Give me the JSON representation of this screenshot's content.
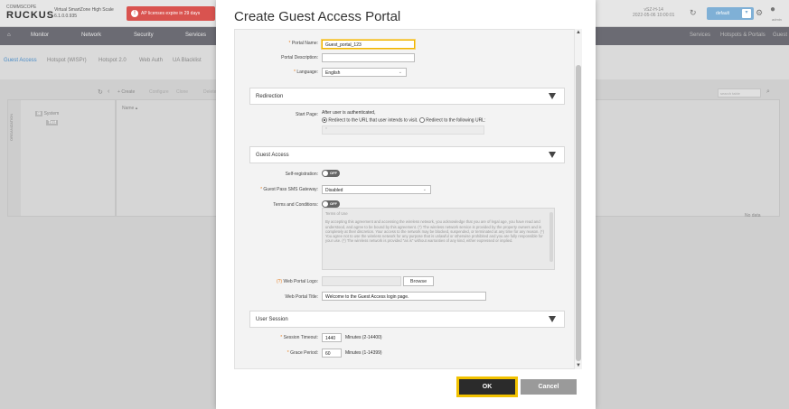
{
  "background": {
    "brand_top": "COMMSCOPE",
    "brand": "RUCKUS",
    "product": "Virtual SmartZone",
    "product_edition": "High Scale",
    "version": "6.1.0.0.935",
    "license_alert": "AP licenses expire in 29 days",
    "controller_name": "vSZ-H-14",
    "controller_date": "2022-05-06 10:00:01",
    "domain_select": "default",
    "user": "admin",
    "nav": [
      "Monitor",
      "Network",
      "Security",
      "Services"
    ],
    "nav_right": [
      "Services",
      "Hotspots & Portals",
      "Guest"
    ],
    "subtabs": [
      "Guest Access",
      "Hotspot (WISPr)",
      "Hotspot 2.0",
      "Web Auth",
      "UA Blacklist"
    ],
    "tree_label": "ORGANIZATION",
    "tree_root": "System",
    "tree_child": "Test",
    "toolbar": [
      "Create",
      "Configure",
      "Clone",
      "Delete"
    ],
    "grid_col": "Name",
    "search_placeholder": "search table",
    "no_data": "No data"
  },
  "modal": {
    "title": "Create Guest Access Portal",
    "portal_name_label": "Portal Name:",
    "portal_name_value": "Guest_portal_123",
    "portal_desc_label": "Portal Description:",
    "portal_desc_value": "",
    "language_label": "Language:",
    "language_value": "English",
    "redirection": {
      "title": "Redirection",
      "start_page_label": "Start Page:",
      "after_auth": "After user is authenticated,",
      "option1": "Redirect to the URL that user intends to visit.",
      "option2": "Redirect to the following URL:",
      "url_required_mark": "*"
    },
    "guest_access": {
      "title": "Guest Access",
      "self_reg_label": "Self-registration:",
      "self_reg_state": "OFF",
      "sms_gateway_label": "Guest Pass SMS Gateway:",
      "sms_gateway_value": "Disabled",
      "terms_label": "Terms and Conditions:",
      "terms_state": "OFF",
      "terms_title": "Terms of Use",
      "terms_body": "By accepting this agreement and accessing the wireless network, you acknowledge that you are of legal age, you have read and understood, and agree to be bound by this agreement. (*) The wireless network service is provided by the property owners and is completely at their discretion. Your access to the network may be blocked, suspended, or terminated at any time for any reason. (*) You agree not to use the wireless network for any purpose that is unlawful or otherwise prohibited and you are fully responsible for your use. (*) The wireless network is provided \"as is\" without warranties of any kind, either expressed or implied.",
      "logo_label": "Web Portal Logo:",
      "logo_mark": "(?)",
      "browse_label": "Browse",
      "title_label": "Web Portal Title:",
      "title_value": "Welcome to the Guest Access login page."
    },
    "user_session": {
      "title": "User Session",
      "timeout_label": "Session Timeout:",
      "timeout_value": "1440",
      "timeout_unit": "Minutes (2-14400)",
      "grace_label": "Grace Period:",
      "grace_value": "60",
      "grace_unit": "Minutes (1-14399)"
    },
    "ok_label": "OK",
    "cancel_label": "Cancel"
  }
}
